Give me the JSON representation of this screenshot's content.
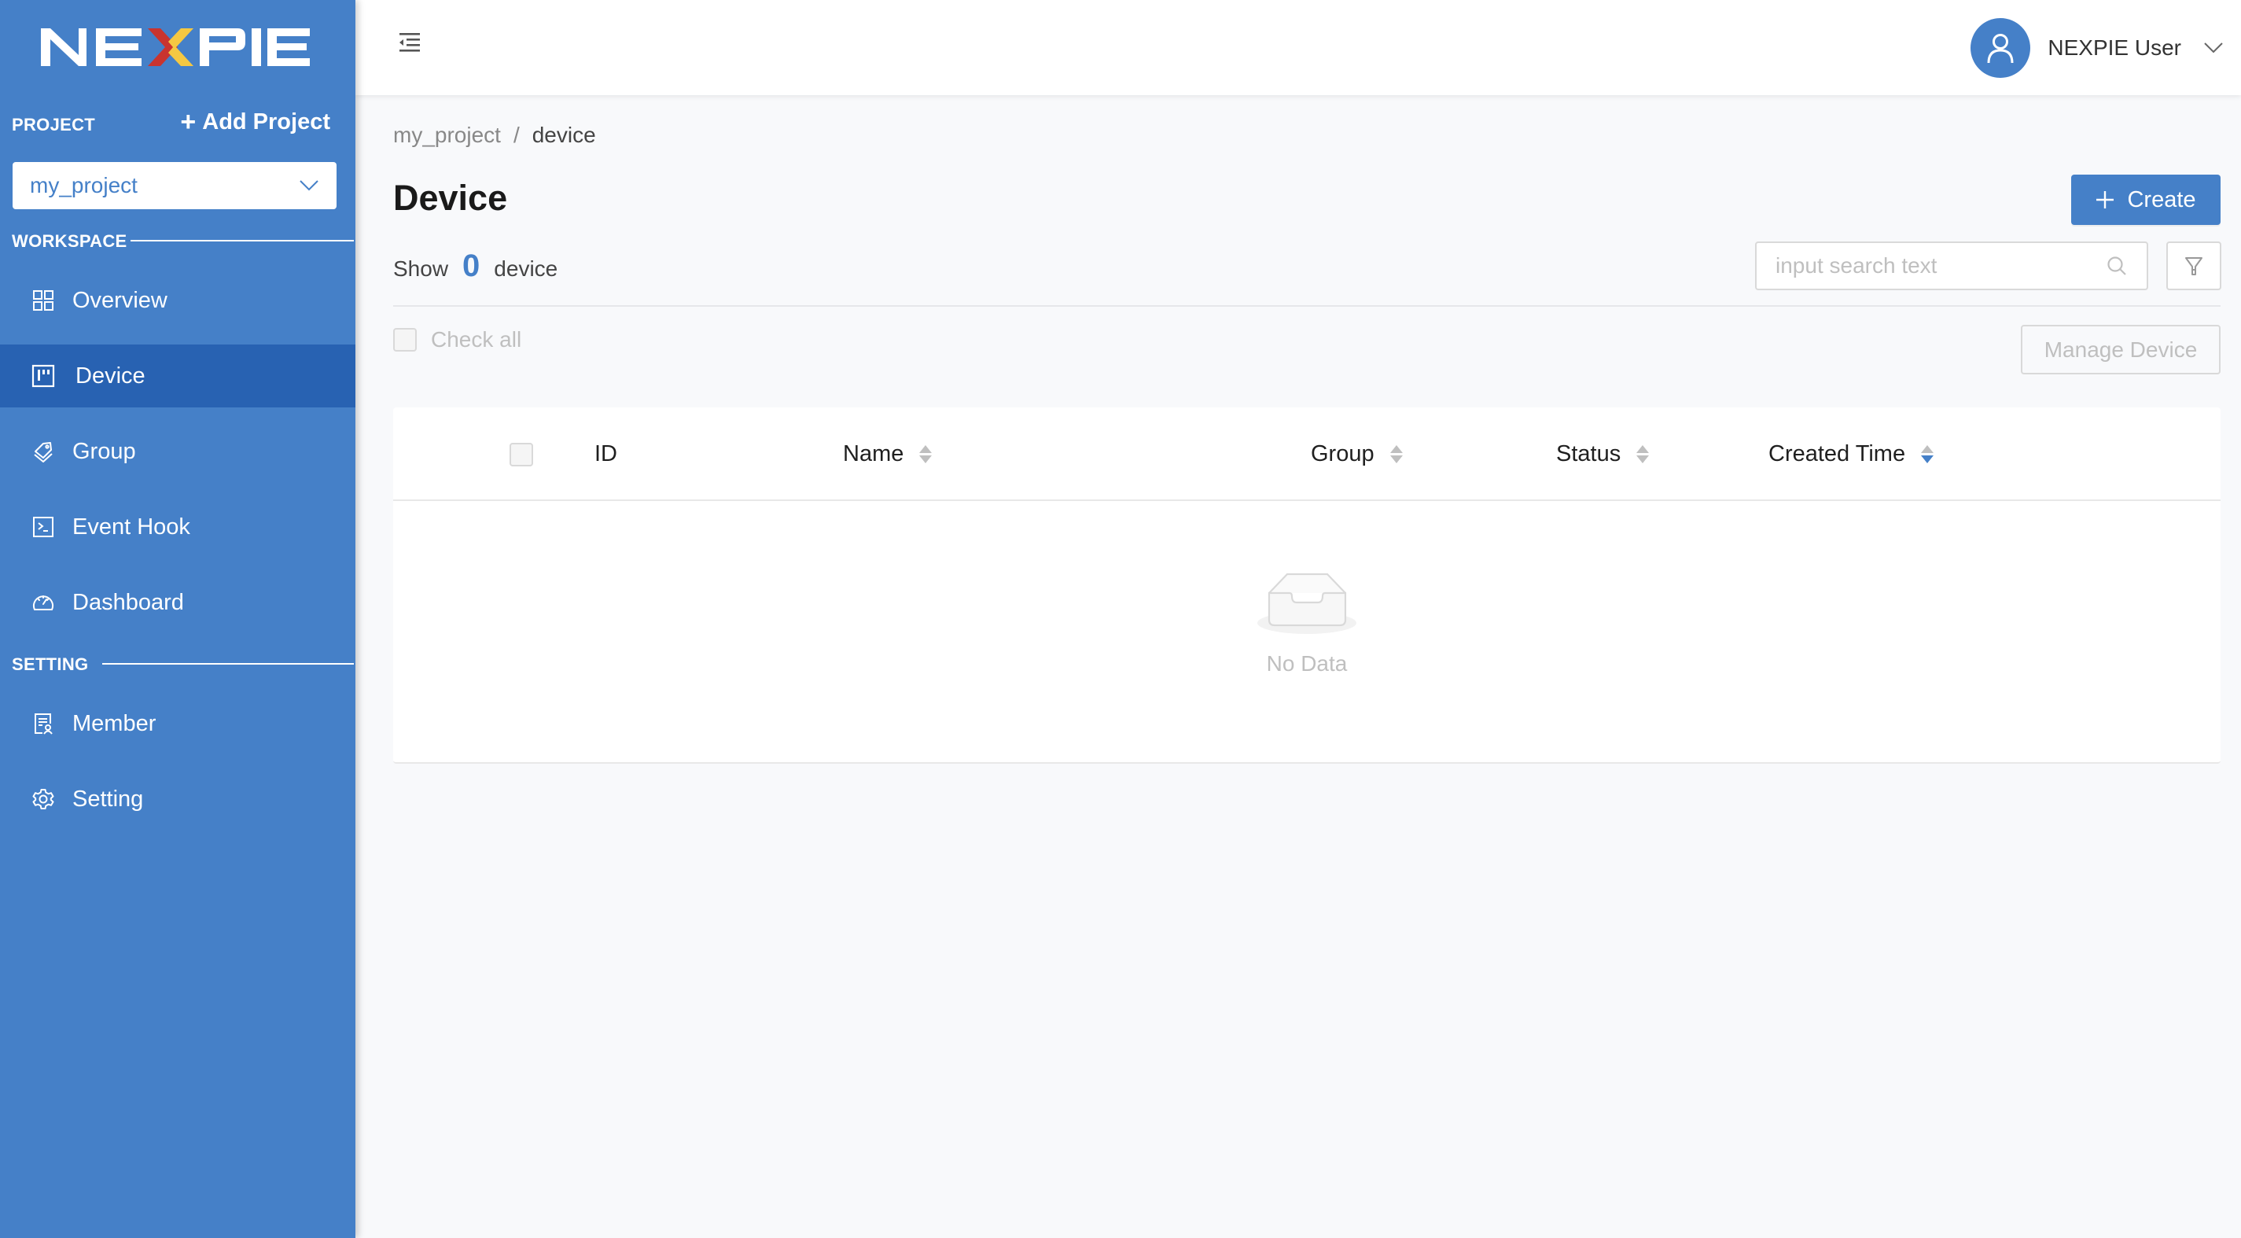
{
  "brand": {
    "logo_text": "NEXPIE",
    "colors": {
      "sidebar": "#4580c8",
      "sidebar_active": "#2862b2",
      "accent": "#4580c8",
      "logo_x_red": "#c9342f",
      "logo_x_yellow": "#f5c842"
    }
  },
  "sidebar": {
    "project_label": "PROJECT",
    "add_project_label": "Add Project",
    "selected_project": "my_project",
    "workspace_label": "WORKSPACE",
    "setting_label": "SETTING",
    "workspace_items": [
      {
        "label": "Overview",
        "icon": "appstore-icon",
        "active": false
      },
      {
        "label": "Device",
        "icon": "project-board-icon",
        "active": true
      },
      {
        "label": "Group",
        "icon": "tags-icon",
        "active": false
      },
      {
        "label": "Event Hook",
        "icon": "terminal-icon",
        "active": false
      },
      {
        "label": "Dashboard",
        "icon": "dashboard-gauge-icon",
        "active": false
      }
    ],
    "setting_items": [
      {
        "label": "Member",
        "icon": "member-profile-icon",
        "active": false
      },
      {
        "label": "Setting",
        "icon": "gear-icon",
        "active": false
      }
    ]
  },
  "header": {
    "user_name": "NEXPIE User"
  },
  "breadcrumb": {
    "items": [
      "my_project",
      "device"
    ],
    "separator": "/"
  },
  "page": {
    "title": "Device",
    "count_prefix": "Show",
    "count": "0",
    "count_suffix": "device",
    "create_label": "Create",
    "search_placeholder": "input search text",
    "search_value": "",
    "check_all_label": "Check all",
    "manage_label": "Manage Device"
  },
  "table": {
    "columns": [
      {
        "label": "ID",
        "sortable": false
      },
      {
        "label": "Name",
        "sortable": true,
        "sort": "none"
      },
      {
        "label": "Group",
        "sortable": true,
        "sort": "none"
      },
      {
        "label": "Status",
        "sortable": true,
        "sort": "none"
      },
      {
        "label": "Created Time",
        "sortable": true,
        "sort": "descend"
      }
    ],
    "rows": [],
    "empty_text": "No Data"
  }
}
